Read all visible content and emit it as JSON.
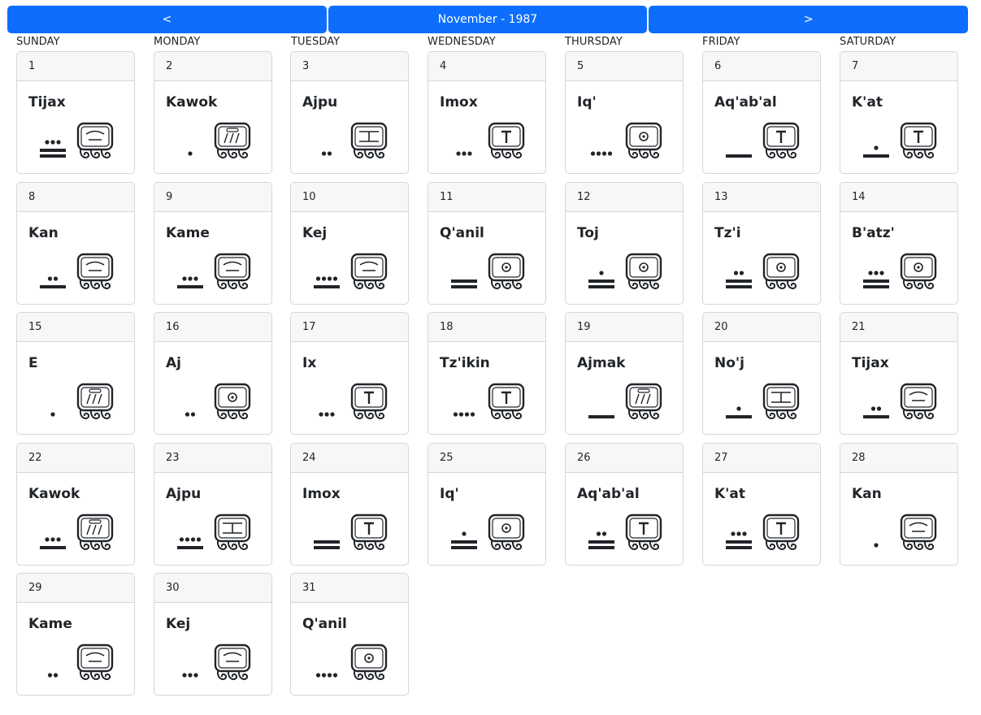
{
  "nav": {
    "prev_label": "<",
    "title": "November - 1987",
    "next_label": ">"
  },
  "weekdays": [
    "SUNDAY",
    "MONDAY",
    "TUESDAY",
    "WEDNESDAY",
    "THURSDAY",
    "FRIDAY",
    "SATURDAY"
  ],
  "days": [
    {
      "date": "1",
      "name": "Tijax",
      "number": 13,
      "glyph": "tijax-glyph-icon"
    },
    {
      "date": "2",
      "name": "Kawok",
      "number": 1,
      "glyph": "kawok-glyph-icon"
    },
    {
      "date": "3",
      "name": "Ajpu",
      "number": 2,
      "glyph": "ajpu-glyph-icon"
    },
    {
      "date": "4",
      "name": "Imox",
      "number": 3,
      "glyph": "imox-glyph-icon"
    },
    {
      "date": "5",
      "name": "Iq'",
      "number": 4,
      "glyph": "iq-glyph-icon"
    },
    {
      "date": "6",
      "name": "Aq'ab'al",
      "number": 5,
      "glyph": "aqabal-glyph-icon"
    },
    {
      "date": "7",
      "name": "K'at",
      "number": 6,
      "glyph": "kat-glyph-icon"
    },
    {
      "date": "8",
      "name": "Kan",
      "number": 7,
      "glyph": "kan-glyph-icon"
    },
    {
      "date": "9",
      "name": "Kame",
      "number": 8,
      "glyph": "kame-glyph-icon"
    },
    {
      "date": "10",
      "name": "Kej",
      "number": 9,
      "glyph": "kej-glyph-icon"
    },
    {
      "date": "11",
      "name": "Q'anil",
      "number": 10,
      "glyph": "qanil-glyph-icon"
    },
    {
      "date": "12",
      "name": "Toj",
      "number": 11,
      "glyph": "toj-glyph-icon"
    },
    {
      "date": "13",
      "name": "Tz'i",
      "number": 12,
      "glyph": "tzi-glyph-icon"
    },
    {
      "date": "14",
      "name": "B'atz'",
      "number": 13,
      "glyph": "batz-glyph-icon"
    },
    {
      "date": "15",
      "name": "E",
      "number": 1,
      "glyph": "e-glyph-icon"
    },
    {
      "date": "16",
      "name": "Aj",
      "number": 2,
      "glyph": "aj-glyph-icon"
    },
    {
      "date": "17",
      "name": "Ix",
      "number": 3,
      "glyph": "ix-glyph-icon"
    },
    {
      "date": "18",
      "name": "Tz'ikin",
      "number": 4,
      "glyph": "tzikin-glyph-icon"
    },
    {
      "date": "19",
      "name": "Ajmak",
      "number": 5,
      "glyph": "ajmak-glyph-icon"
    },
    {
      "date": "20",
      "name": "No'j",
      "number": 6,
      "glyph": "noj-glyph-icon"
    },
    {
      "date": "21",
      "name": "Tijax",
      "number": 7,
      "glyph": "tijax-glyph-icon"
    },
    {
      "date": "22",
      "name": "Kawok",
      "number": 8,
      "glyph": "kawok-glyph-icon"
    },
    {
      "date": "23",
      "name": "Ajpu",
      "number": 9,
      "glyph": "ajpu-glyph-icon"
    },
    {
      "date": "24",
      "name": "Imox",
      "number": 10,
      "glyph": "imox-glyph-icon"
    },
    {
      "date": "25",
      "name": "Iq'",
      "number": 11,
      "glyph": "iq-glyph-icon"
    },
    {
      "date": "26",
      "name": "Aq'ab'al",
      "number": 12,
      "glyph": "aqabal-glyph-icon"
    },
    {
      "date": "27",
      "name": "K'at",
      "number": 13,
      "glyph": "kat-glyph-icon"
    },
    {
      "date": "28",
      "name": "Kan",
      "number": 1,
      "glyph": "kan-glyph-icon"
    },
    {
      "date": "29",
      "name": "Kame",
      "number": 2,
      "glyph": "kame-glyph-icon"
    },
    {
      "date": "30",
      "name": "Kej",
      "number": 3,
      "glyph": "kej-glyph-icon"
    },
    {
      "date": "31",
      "name": "Q'anil",
      "number": 4,
      "glyph": "qanil-glyph-icon"
    }
  ],
  "colors": {
    "accent": "#0d6efd",
    "header_bg": "#f7f7f7",
    "border": "#d6d6d6",
    "ink": "#212529"
  }
}
